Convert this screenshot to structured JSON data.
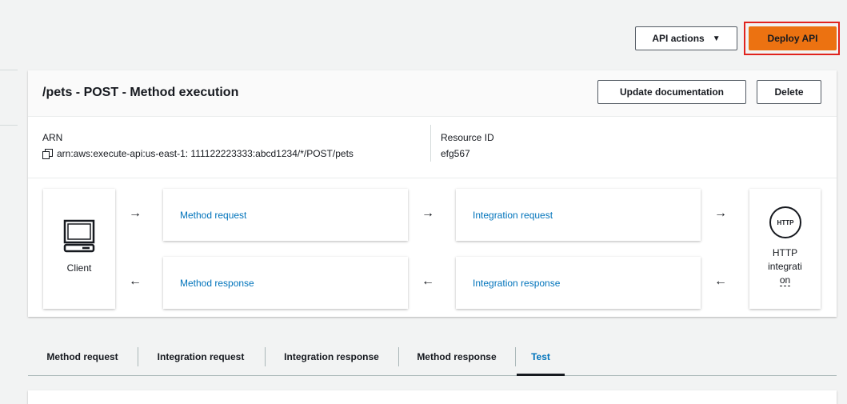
{
  "toolbar": {
    "api_actions_label": "API actions",
    "deploy_label": "Deploy API"
  },
  "method": {
    "title": "/pets - POST - Method execution",
    "update_doc_label": "Update documentation",
    "delete_label": "Delete",
    "arn_label": "ARN",
    "arn_value": "arn:aws:execute-api:us-east-1: 111122223333:abcd1234/*/POST/pets",
    "resource_id_label": "Resource ID",
    "resource_id_value": "efg567"
  },
  "flow": {
    "client_label": "Client",
    "method_request": "Method request",
    "method_response": "Method response",
    "integration_request": "Integration request",
    "integration_response": "Integration response",
    "http_icon_text": "HTTP",
    "http_line1": "HTTP",
    "http_line2": "integrati",
    "http_line3": "on",
    "arrow_right": "→",
    "arrow_left": "←"
  },
  "tabs": [
    {
      "label": "Method request"
    },
    {
      "label": "Integration request"
    },
    {
      "label": "Integration response"
    },
    {
      "label": "Method response"
    },
    {
      "label": "Test",
      "active": true
    }
  ],
  "colors": {
    "accent": "#0073bb",
    "deploy": "#ec7211",
    "highlight": "#e0231e"
  }
}
